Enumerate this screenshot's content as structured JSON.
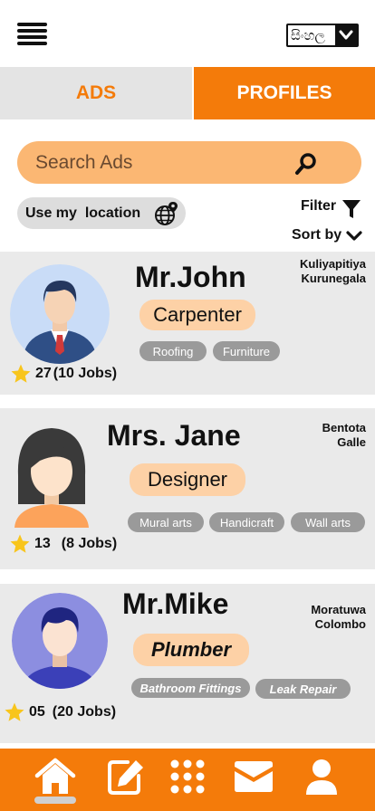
{
  "header": {
    "language_label": "සිංහල"
  },
  "tabs": [
    {
      "label": "ADS"
    },
    {
      "label": "PROFILES"
    }
  ],
  "search": {
    "placeholder": "Search Ads"
  },
  "controls": {
    "location_label": "Use my  location",
    "filter_label": "Filter",
    "sort_label": "Sort by"
  },
  "profiles": [
    {
      "name": "Mr.John",
      "role": "Carpenter",
      "location_line1": "Kuliyapitiya",
      "location_line2": "Kurunegala",
      "tags": [
        "Roofing",
        "Furniture"
      ],
      "rating": "27",
      "jobs": "(10 Jobs)"
    },
    {
      "name": "Mrs. Jane",
      "role": "Designer",
      "location_line1": "Bentota",
      "location_line2": "Galle",
      "tags": [
        "Mural arts",
        "Handicraft",
        "Wall arts"
      ],
      "rating": "13",
      "jobs": "(8 Jobs)"
    },
    {
      "name": "Mr.Mike",
      "role": "Plumber",
      "location_line1": "Moratuwa",
      "location_line2": "Colombo",
      "tags": [
        "Bathroom Fittings",
        "Leak Repair"
      ],
      "rating": "05",
      "jobs": "(20 Jobs)"
    }
  ],
  "bottom_nav": {
    "items": [
      "home-icon",
      "edit-icon",
      "grid-icon",
      "mail-icon",
      "user-icon"
    ],
    "active": "home-icon"
  },
  "colors": {
    "accent": "#f47b0a",
    "search_bg": "#fbb773",
    "role_badge": "#fdd1a6",
    "tag_bg": "#9a9a9a",
    "card_bg": "#eaeaea",
    "star": "#f8c51c"
  }
}
